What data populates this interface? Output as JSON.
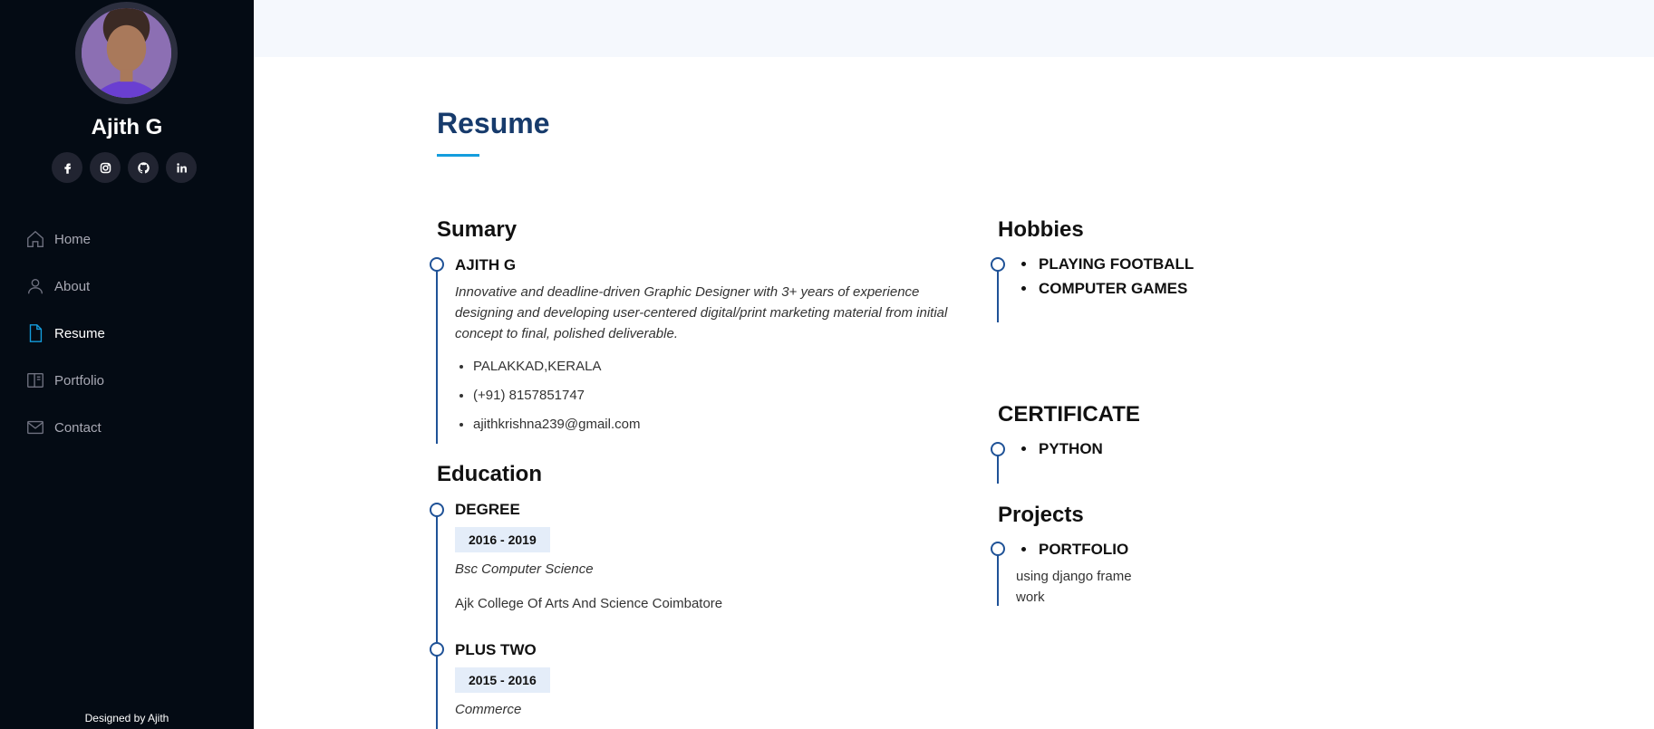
{
  "sidebar": {
    "name": "Ajith G",
    "social": [
      "facebook-icon",
      "instagram-icon",
      "github-icon",
      "linkedin-icon"
    ],
    "nav": [
      {
        "label": "Home",
        "icon": "home-icon",
        "active": false
      },
      {
        "label": "About",
        "icon": "person-icon",
        "active": false
      },
      {
        "label": "Resume",
        "icon": "file-icon",
        "active": true
      },
      {
        "label": "Portfolio",
        "icon": "book-icon",
        "active": false
      },
      {
        "label": "Contact",
        "icon": "envelope-icon",
        "active": false
      }
    ],
    "credits": "Designed by Ajith"
  },
  "colors": {
    "sidebar_bg": "#040b14",
    "accent": "#149ddd",
    "title": "#173b6c",
    "timeline": "#1f5297"
  },
  "main": {
    "title": "Resume",
    "summary": {
      "heading": "Sumary",
      "name": "AJITH G",
      "text": "Innovative and deadline-driven Graphic Designer with 3+ years of experience designing and developing user-centered digital/print marketing material from initial concept to final, polished deliverable.",
      "contact": [
        "PALAKKAD,KERALA",
        "(+91) 8157851747",
        "ajithkrishna239@gmail.com"
      ]
    },
    "education": {
      "heading": "Education",
      "items": [
        {
          "title": "DEGREE",
          "years": "2016 - 2019",
          "course": "Bsc Computer Science",
          "school": "Ajk College Of Arts And Science Coimbatore"
        },
        {
          "title": "PLUS TWO",
          "years": "2015 - 2016",
          "course": "Commerce"
        }
      ]
    },
    "hobbies": {
      "heading": "Hobbies",
      "items": [
        "PLAYING FOOTBALL",
        "COMPUTER GAMES"
      ]
    },
    "certificate": {
      "heading": "CERTIFICATE",
      "items": [
        "PYTHON"
      ]
    },
    "projects": {
      "heading": "Projects",
      "items": [
        "PORTFOLIO"
      ],
      "desc": "using django frame work"
    }
  }
}
